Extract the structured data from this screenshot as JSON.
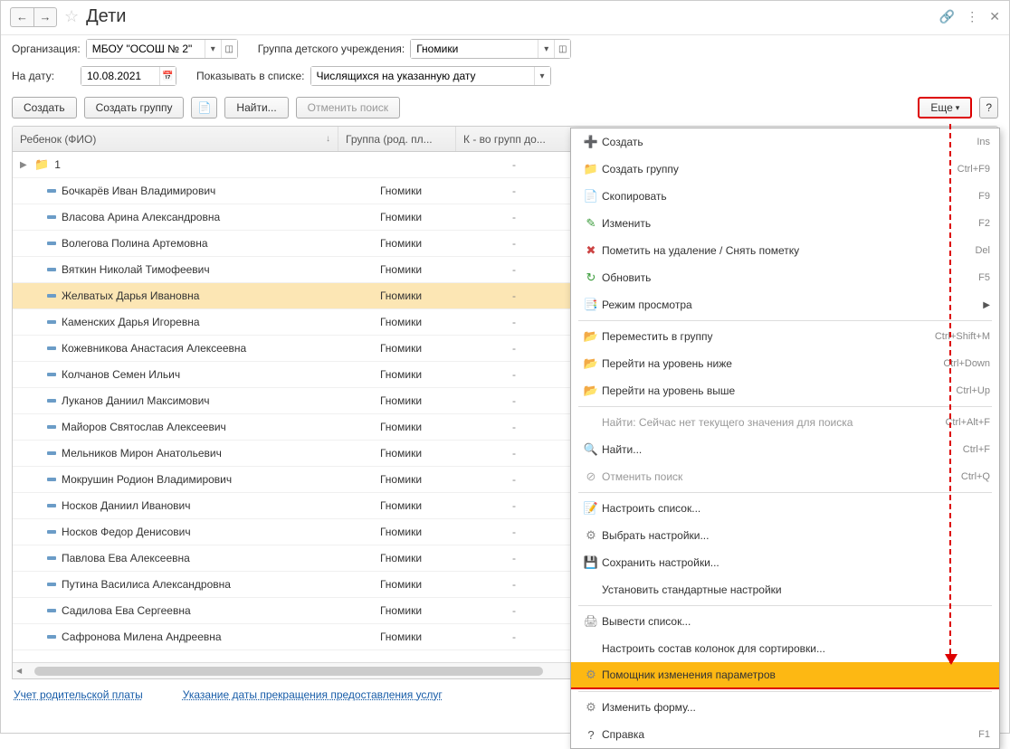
{
  "header": {
    "title": "Дети"
  },
  "filters": {
    "org_label": "Организация:",
    "org_value": "МБОУ \"ОСОШ № 2\"",
    "group_label": "Группа детского учреждения:",
    "group_value": "Гномики",
    "date_label": "На дату:",
    "date_value": "10.08.2021",
    "show_label": "Показывать в списке:",
    "show_value": "Числящихся на указанную дату"
  },
  "toolbar": {
    "create": "Создать",
    "create_group": "Создать группу",
    "find": "Найти...",
    "cancel_search": "Отменить поиск",
    "more": "Еще",
    "help": "?"
  },
  "columns": {
    "c1": "Ребенок (ФИО)",
    "c2": "Группа (род. пл...",
    "c3": "К - во групп до..."
  },
  "rows": [
    {
      "type": "folder",
      "name": "1",
      "group": "",
      "dash": "-"
    },
    {
      "type": "item",
      "name": "Бочкарёв Иван Владимирович",
      "group": "Гномики",
      "dash": "-"
    },
    {
      "type": "item",
      "name": "Власова Арина Александровна",
      "group": "Гномики",
      "dash": "-"
    },
    {
      "type": "item",
      "name": "Волегова Полина Артемовна",
      "group": "Гномики",
      "dash": "-"
    },
    {
      "type": "item",
      "name": "Вяткин Николай Тимофеевич",
      "group": "Гномики",
      "dash": "-"
    },
    {
      "type": "item",
      "name": "Желватых Дарья Ивановна",
      "group": "Гномики",
      "dash": "-",
      "selected": true
    },
    {
      "type": "item",
      "name": "Каменских Дарья Игоревна",
      "group": "Гномики",
      "dash": "-"
    },
    {
      "type": "item",
      "name": "Кожевникова Анастасия Алексеевна",
      "group": "Гномики",
      "dash": "-"
    },
    {
      "type": "item",
      "name": "Колчанов Семен Ильич",
      "group": "Гномики",
      "dash": "-"
    },
    {
      "type": "item",
      "name": "Луканов Даниил Максимович",
      "group": "Гномики",
      "dash": "-"
    },
    {
      "type": "item",
      "name": "Майоров Святослав Алексеевич",
      "group": "Гномики",
      "dash": "-"
    },
    {
      "type": "item",
      "name": "Мельников Мирон Анатольевич",
      "group": "Гномики",
      "dash": "-"
    },
    {
      "type": "item",
      "name": "Мокрушин Родион Владимирович",
      "group": "Гномики",
      "dash": "-"
    },
    {
      "type": "item",
      "name": "Носков Даниил Иванович",
      "group": "Гномики",
      "dash": "-"
    },
    {
      "type": "item",
      "name": "Носков Федор Денисович",
      "group": "Гномики",
      "dash": "-"
    },
    {
      "type": "item",
      "name": "Павлова Ева Алексеевна",
      "group": "Гномики",
      "dash": "-"
    },
    {
      "type": "item",
      "name": "Путина Василиса Александровна",
      "group": "Гномики",
      "dash": "-"
    },
    {
      "type": "item",
      "name": "Садилова Ева Сергеевна",
      "group": "Гномики",
      "dash": "-"
    },
    {
      "type": "item",
      "name": "Сафронова Милена Андреевна",
      "group": "Гномики",
      "dash": "-"
    }
  ],
  "footer": {
    "link1": "Учет родительской платы",
    "link2": "Указание даты прекращения предоставления услуг"
  },
  "menu": [
    {
      "icon": "➕",
      "color": "#3a9b3a",
      "label": "Создать",
      "shortcut": "Ins"
    },
    {
      "icon": "📁",
      "color": "#e8a951",
      "label": "Создать группу",
      "shortcut": "Ctrl+F9"
    },
    {
      "icon": "📄",
      "color": "#3a9b3a",
      "label": "Скопировать",
      "shortcut": "F9"
    },
    {
      "icon": "✎",
      "color": "#3a9b3a",
      "label": "Изменить",
      "shortcut": "F2"
    },
    {
      "icon": "✖",
      "color": "#c44",
      "label": "Пометить на удаление / Снять пометку",
      "shortcut": "Del"
    },
    {
      "icon": "↻",
      "color": "#3a9b3a",
      "label": "Обновить",
      "shortcut": "F5"
    },
    {
      "icon": "📑",
      "color": "#5a8fb8",
      "label": "Режим просмотра",
      "submenu": true
    },
    {
      "sep": true
    },
    {
      "icon": "📂",
      "color": "#e8a951",
      "label": "Переместить в группу",
      "shortcut": "Ctrl+Shift+M"
    },
    {
      "icon": "📂",
      "color": "#e8a951",
      "label": "Перейти на уровень ниже",
      "shortcut": "Ctrl+Down"
    },
    {
      "icon": "📂",
      "color": "#e8a951",
      "label": "Перейти на уровень выше",
      "shortcut": "Ctrl+Up"
    },
    {
      "sep": true
    },
    {
      "icon": "",
      "label": "Найти: Сейчас нет текущего значения для поиска",
      "shortcut": "Ctrl+Alt+F",
      "disabled": true
    },
    {
      "icon": "🔍",
      "color": "#555",
      "label": "Найти...",
      "shortcut": "Ctrl+F"
    },
    {
      "icon": "⊘",
      "color": "#aaa",
      "label": "Отменить поиск",
      "shortcut": "Ctrl+Q",
      "disabled": true
    },
    {
      "sep": true
    },
    {
      "icon": "📝",
      "color": "#5a8fb8",
      "label": "Настроить список..."
    },
    {
      "icon": "⚙",
      "color": "#888",
      "label": "Выбрать настройки..."
    },
    {
      "icon": "💾",
      "color": "#5a8fb8",
      "label": "Сохранить настройки..."
    },
    {
      "icon": "",
      "label": "Установить стандартные настройки"
    },
    {
      "sep": true
    },
    {
      "icon": "🖨",
      "color": "#888",
      "label": "Вывести список..."
    },
    {
      "icon": "",
      "label": "Настроить состав колонок для сортировки..."
    },
    {
      "icon": "⚙",
      "color": "#888",
      "label": "Помощник изменения параметров",
      "highlight": true
    },
    {
      "sep": true
    },
    {
      "icon": "⚙",
      "color": "#888",
      "label": "Изменить форму..."
    },
    {
      "icon": "?",
      "color": "#555",
      "label": "Справка",
      "shortcut": "F1"
    }
  ]
}
